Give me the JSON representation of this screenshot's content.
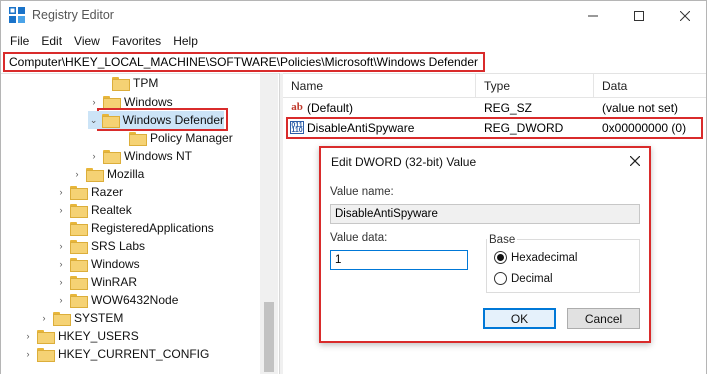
{
  "window": {
    "title": "Registry Editor"
  },
  "menu": [
    "File",
    "Edit",
    "View",
    "Favorites",
    "Help"
  ],
  "address": "Computer\\HKEY_LOCAL_MACHINE\\SOFTWARE\\Policies\\Microsoft\\Windows Defender",
  "tree": {
    "items": [
      {
        "label": "TPM",
        "expander": ""
      },
      {
        "label": "Windows",
        "expander": "›"
      },
      {
        "label": "Windows Defender",
        "expander": "⌄",
        "selected": true
      },
      {
        "label": "Policy Manager",
        "expander": ""
      },
      {
        "label": "Windows NT",
        "expander": "›"
      },
      {
        "label": "Mozilla",
        "expander": "›"
      },
      {
        "label": "Razer",
        "expander": "›"
      },
      {
        "label": "Realtek",
        "expander": "›"
      },
      {
        "label": "RegisteredApplications",
        "expander": ""
      },
      {
        "label": "SRS Labs",
        "expander": "›"
      },
      {
        "label": "Windows",
        "expander": "›"
      },
      {
        "label": "WinRAR",
        "expander": "›"
      },
      {
        "label": "WOW6432Node",
        "expander": "›"
      },
      {
        "label": "SYSTEM",
        "expander": "›"
      },
      {
        "label": "HKEY_USERS",
        "expander": "›"
      },
      {
        "label": "HKEY_CURRENT_CONFIG",
        "expander": "›"
      }
    ]
  },
  "list": {
    "headers": {
      "name": "Name",
      "type": "Type",
      "data": "Data"
    },
    "rows": [
      {
        "name": "(Default)",
        "type": "REG_SZ",
        "data": "(value not set)",
        "icon": "string-value-icon"
      },
      {
        "name": "DisableAntiSpyware",
        "type": "REG_DWORD",
        "data": "0x00000000 (0)",
        "icon": "binary-value-icon"
      }
    ]
  },
  "dialog": {
    "title": "Edit DWORD (32-bit) Value",
    "value_name_label": "Value name:",
    "value_name": "DisableAntiSpyware",
    "value_data_label": "Value data:",
    "value_data": "1",
    "base_label": "Base",
    "radio_hex": "Hexadecimal",
    "radio_dec": "Decimal",
    "ok": "OK",
    "cancel": "Cancel"
  },
  "colors": {
    "highlight_red": "#d92b2b",
    "selection_blue": "#cce4f7",
    "accent_blue": "#0078d7",
    "folder_yellow": "#f5d274"
  }
}
